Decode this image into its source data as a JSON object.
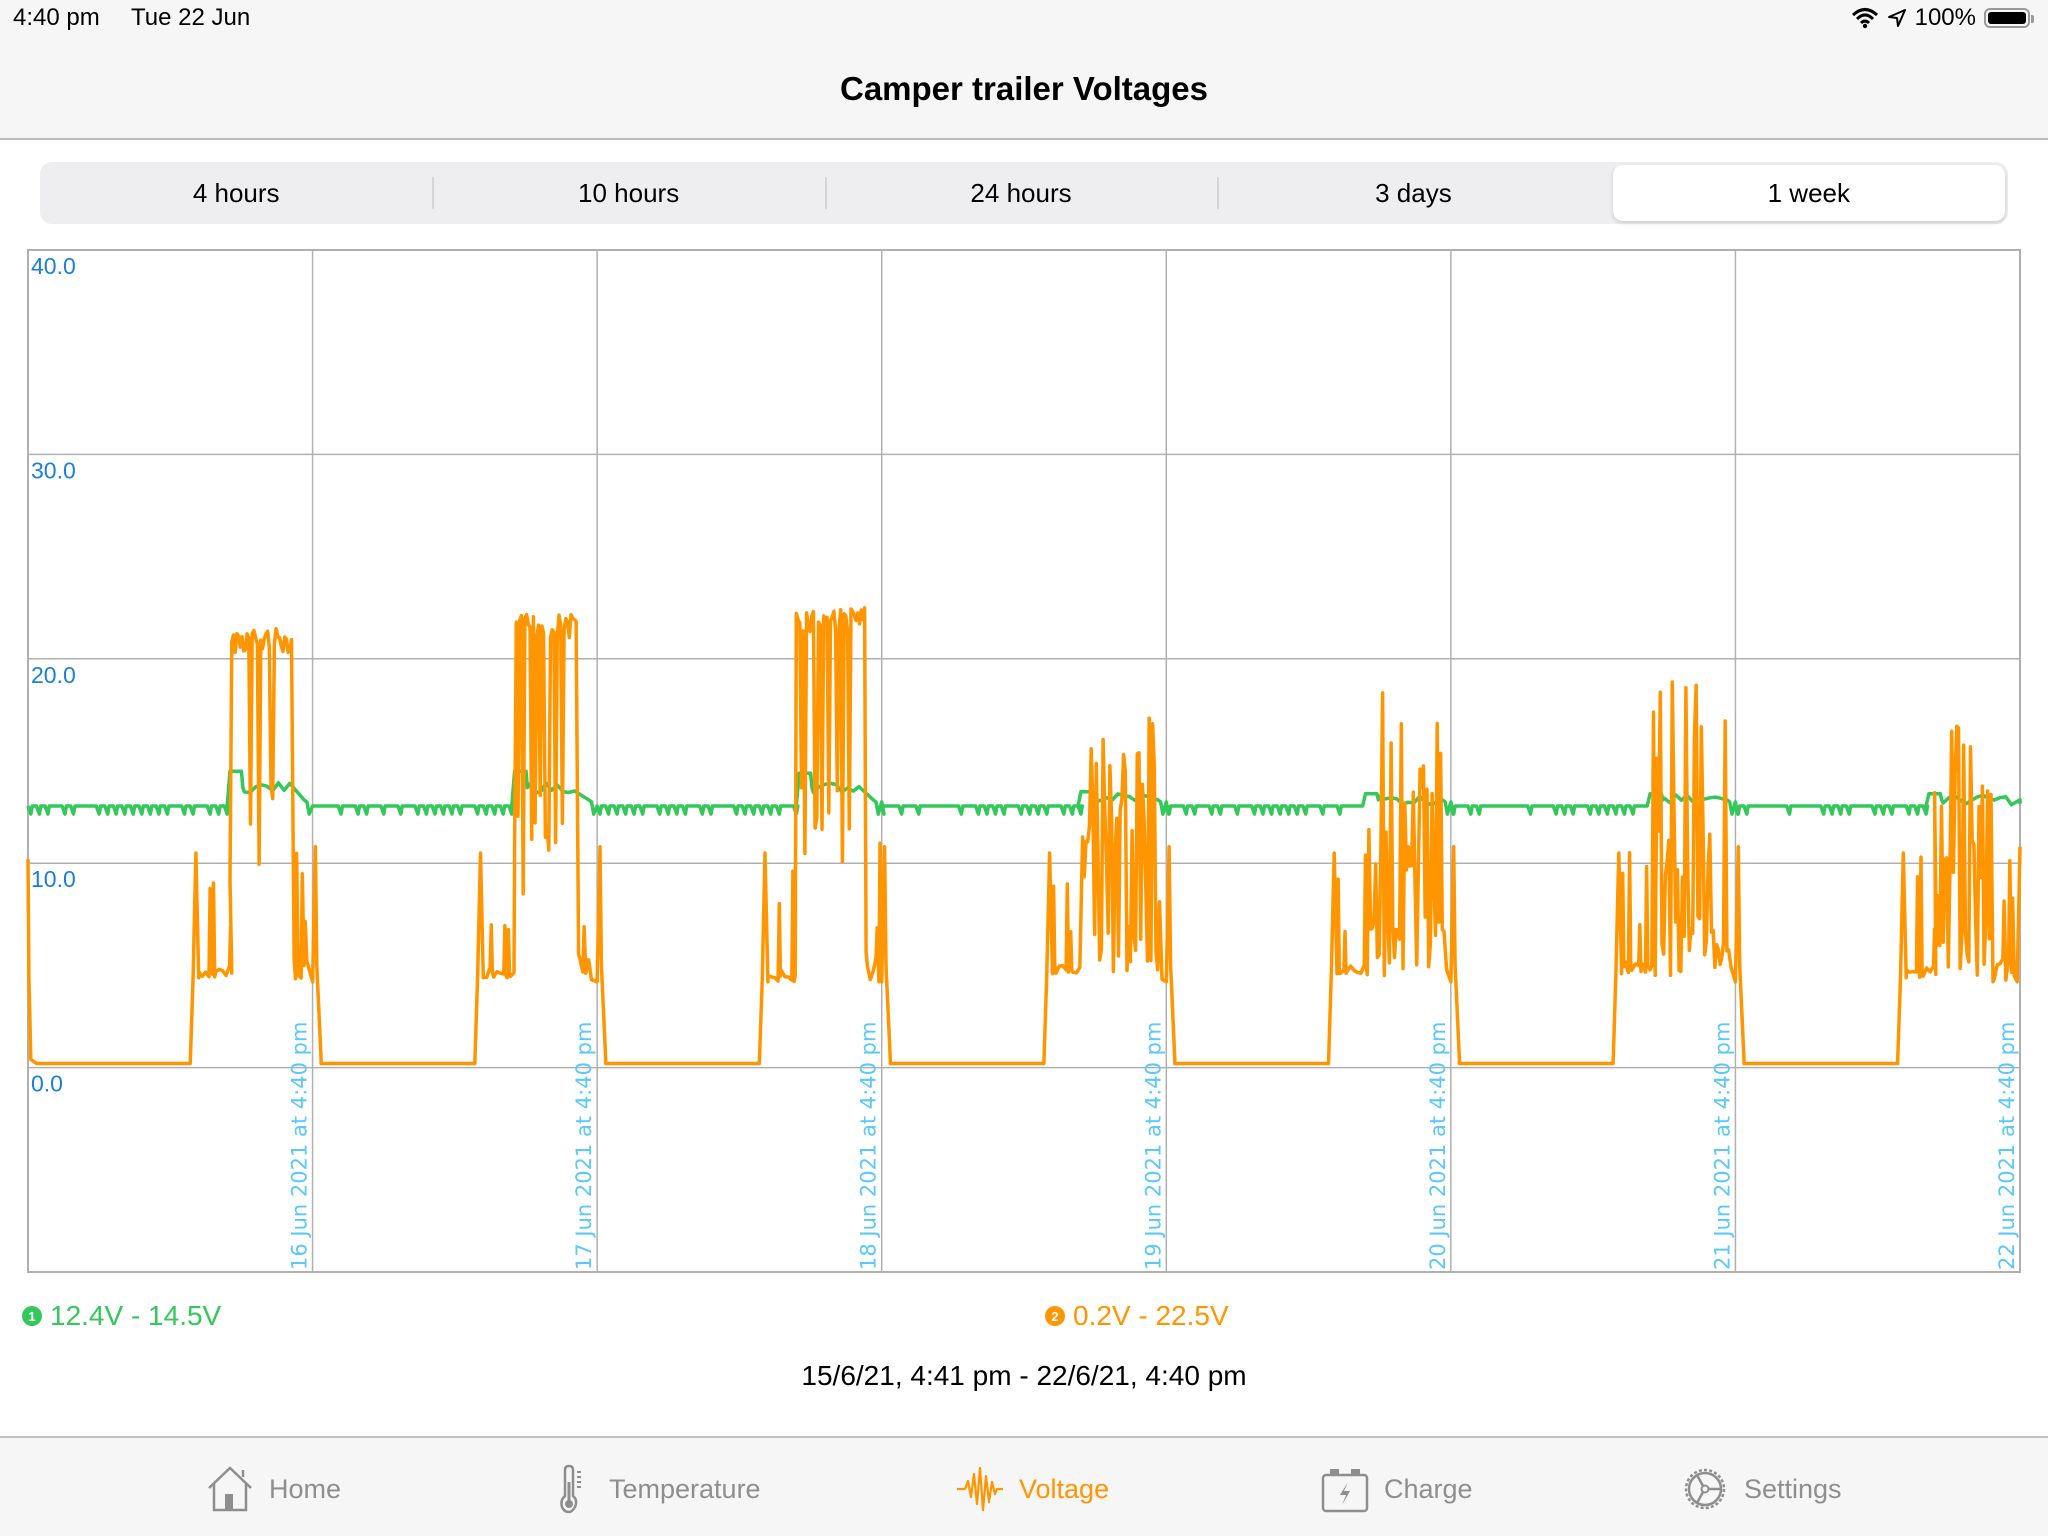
{
  "status_bar": {
    "time": "4:40 pm",
    "date": "Tue 22 Jun",
    "battery_percent": "100%",
    "icons": [
      "wifi-icon",
      "location-icon",
      "battery-icon"
    ]
  },
  "nav": {
    "title": "Camper trailer Voltages"
  },
  "segments": [
    {
      "label": "4 hours",
      "active": false
    },
    {
      "label": "10 hours",
      "active": false
    },
    {
      "label": "24 hours",
      "active": false
    },
    {
      "label": "3 days",
      "active": false
    },
    {
      "label": "1 week",
      "active": true
    }
  ],
  "colors": {
    "series1": "#34c759",
    "series2": "#ff9500",
    "axis_label": "#1a7fd9",
    "x_label": "#5ac8fa",
    "grid": "#b0b0b0",
    "tab_inactive": "#8e8e8e",
    "tab_active": "#ff9500"
  },
  "chart_data": {
    "type": "line",
    "title": "Camper trailer Voltages",
    "xlabel": "",
    "ylabel": "",
    "ylim": [
      -10,
      40
    ],
    "y_ticks": [
      "40.0",
      "30.0",
      "20.0",
      "10.0",
      "0.0"
    ],
    "y_tick_values": [
      40,
      30,
      20,
      10,
      0
    ],
    "x_range_days": [
      0,
      7
    ],
    "x_ticks": [
      "16 Jun 2021 at 4:40 pm",
      "17 Jun 2021 at 4:40 pm",
      "18 Jun 2021 at 4:40 pm",
      "19 Jun 2021 at 4:40 pm",
      "20 Jun 2021 at 4:40 pm",
      "21 Jun 2021 at 4:40 pm",
      "22 Jun 2021 at 4:40 pm"
    ],
    "grid": true,
    "legend": "bottom",
    "series": [
      {
        "name": "1",
        "range_label": "12.4V - 14.5V",
        "min": 12.4,
        "max": 14.5,
        "baseline": 12.8,
        "daily_profile": [
          {
            "day": 0,
            "rise": 0.7,
            "peak": 14.5,
            "step": 13.7,
            "fall": 0.97
          },
          {
            "day": 1,
            "rise": 0.7,
            "peak": 14.5,
            "step": 13.7,
            "fall": 0.97
          },
          {
            "day": 2,
            "rise": 0.7,
            "peak": 14.4,
            "step": 13.7,
            "fall": 0.97
          },
          {
            "day": 3,
            "rise": 0.69,
            "peak": 13.5,
            "step": 13.2,
            "fall": 0.97
          },
          {
            "day": 4,
            "rise": 0.69,
            "peak": 13.4,
            "step": 13.1,
            "fall": 0.97
          },
          {
            "day": 5,
            "rise": 0.69,
            "peak": 13.4,
            "step": 13.1,
            "fall": 0.97
          },
          {
            "day": 6,
            "rise": 0.67,
            "peak": 13.4,
            "step": 13.1,
            "fall": 1.0
          }
        ]
      },
      {
        "name": "2",
        "range_label": "0.2V - 22.5V",
        "min": 0.2,
        "max": 22.5,
        "night_value": 0.2,
        "daily_profile": [
          {
            "day": 0,
            "wake": 0.58,
            "low_plateau": 4.4,
            "high_start": 0.71,
            "high_end": 0.93,
            "peak": 21.5,
            "end": 1.01,
            "spikiness": "plateau"
          },
          {
            "day": 1,
            "wake": 0.58,
            "low_plateau": 4.4,
            "high_start": 0.71,
            "high_end": 0.93,
            "peak": 22.2,
            "end": 1.01,
            "spikiness": "plateau"
          },
          {
            "day": 2,
            "wake": 0.58,
            "low_plateau": 4.2,
            "high_start": 0.7,
            "high_end": 0.94,
            "peak": 22.5,
            "end": 1.01,
            "spikiness": "plateau"
          },
          {
            "day": 3,
            "wake": 0.58,
            "low_plateau": 4.6,
            "high_start": 0.7,
            "high_end": 0.98,
            "peak": 17.3,
            "end": 1.01,
            "spikiness": "spiky"
          },
          {
            "day": 4,
            "wake": 0.58,
            "low_plateau": 4.6,
            "high_start": 0.7,
            "high_end": 0.98,
            "peak": 19.2,
            "end": 1.01,
            "spikiness": "spiky"
          },
          {
            "day": 5,
            "wake": 0.58,
            "low_plateau": 4.6,
            "high_start": 0.7,
            "high_end": 0.98,
            "peak": 19.5,
            "end": 1.01,
            "spikiness": "spiky"
          },
          {
            "day": 6,
            "wake": 0.58,
            "low_plateau": 4.4,
            "high_start": 0.7,
            "high_end": 0.9,
            "peak": 16.8,
            "end": 1.0,
            "spikiness": "spiky"
          }
        ],
        "start_value": 10.2
      }
    ]
  },
  "legend": [
    {
      "badge": "1",
      "label": "12.4V - 14.5V"
    },
    {
      "badge": "2",
      "label": "0.2V - 22.5V"
    }
  ],
  "date_range": "15/6/21, 4:41 pm - 22/6/21, 4:40 pm",
  "tabs": [
    {
      "label": "Home",
      "icon": "home-icon",
      "active": false
    },
    {
      "label": "Temperature",
      "icon": "thermometer-icon",
      "active": false
    },
    {
      "label": "Voltage",
      "icon": "waveform-icon",
      "active": true
    },
    {
      "label": "Charge",
      "icon": "battery-charge-icon",
      "active": false
    },
    {
      "label": "Settings",
      "icon": "gear-icon",
      "active": false
    }
  ]
}
